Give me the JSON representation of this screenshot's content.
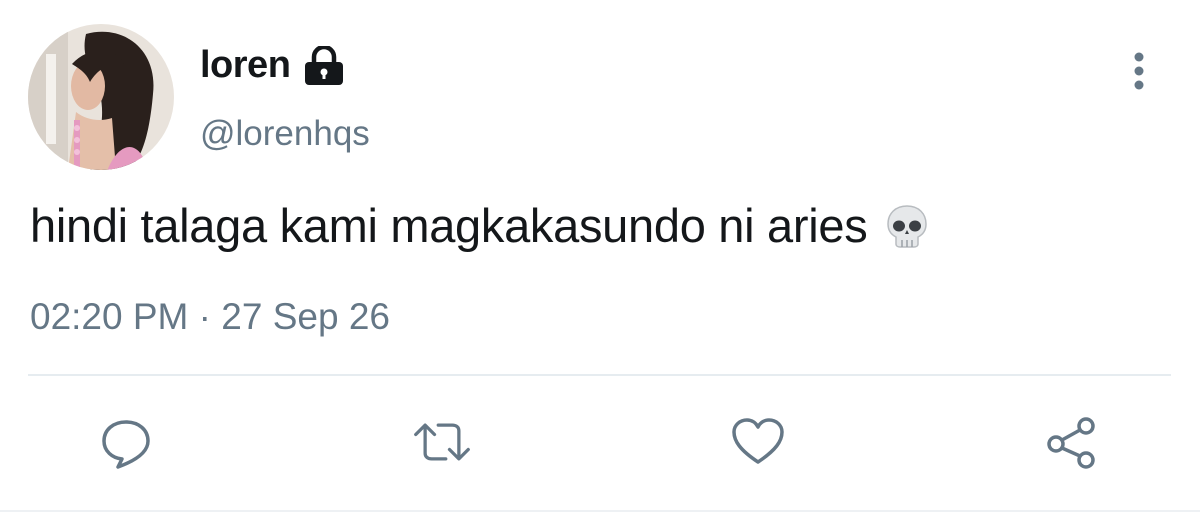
{
  "author": {
    "display_name": "loren",
    "handle": "@lorenhqs",
    "protected": true
  },
  "tweet": {
    "text": "hindi talaga kami magkakasundo ni aries",
    "emoji": "skull-emoji",
    "time": "02:20 PM",
    "separator": "·",
    "date": "27 Sep 26"
  },
  "icons": {
    "lock": "lock-icon",
    "more": "more-vertical-icon",
    "reply": "reply-icon",
    "retweet": "retweet-icon",
    "like": "heart-icon",
    "share": "share-icon"
  },
  "colors": {
    "text_primary": "#14171a",
    "text_secondary": "#657786",
    "icon": "#657786",
    "divider": "#e6ecf0",
    "background": "#ffffff"
  }
}
